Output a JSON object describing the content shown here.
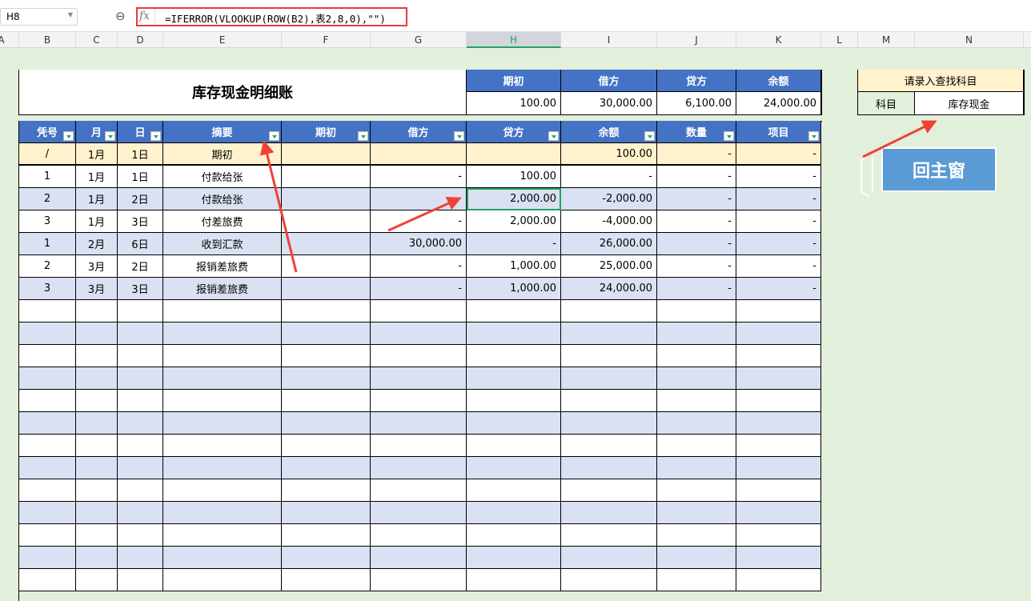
{
  "formula_bar": {
    "cell_ref": "H8",
    "fx": "fx",
    "formula": "=IFERROR(VLOOKUP(ROW(B2),表2,8,0),\"\")"
  },
  "columns": [
    "A",
    "B",
    "C",
    "D",
    "E",
    "F",
    "G",
    "H",
    "I",
    "J",
    "K",
    "L",
    "M",
    "N"
  ],
  "title": "库存现金明细账",
  "summary": {
    "headers": [
      "期初",
      "借方",
      "贷方",
      "余额"
    ],
    "values": [
      "100.00",
      "30,000.00",
      "6,100.00",
      "24,000.00"
    ]
  },
  "table": {
    "headers": [
      "凭号",
      "月",
      "日",
      "摘要",
      "期初",
      "借方",
      "贷方",
      "余额",
      "数量",
      "项目"
    ],
    "rows": [
      [
        "/",
        "1月",
        "1日",
        "期初",
        "",
        "",
        "",
        "100.00",
        "-",
        "-"
      ],
      [
        "1",
        "1月",
        "1日",
        "付款给张",
        "",
        "-",
        "100.00",
        "-",
        "-",
        "-"
      ],
      [
        "2",
        "1月",
        "2日",
        "付款给张",
        "",
        "",
        "2,000.00",
        "-2,000.00",
        "-",
        "-"
      ],
      [
        "3",
        "1月",
        "3日",
        "付差旅费",
        "",
        "-",
        "2,000.00",
        "-4,000.00",
        "-",
        "-"
      ],
      [
        "1",
        "2月",
        "6日",
        "收到汇款",
        "",
        "30,000.00",
        "-",
        "26,000.00",
        "-",
        "-"
      ],
      [
        "2",
        "3月",
        "2日",
        "报销差旅费",
        "",
        "-",
        "1,000.00",
        "25,000.00",
        "-",
        "-"
      ],
      [
        "3",
        "3月",
        "3日",
        "报销差旅费",
        "",
        "-",
        "1,000.00",
        "24,000.00",
        "-",
        "-"
      ]
    ]
  },
  "lookup": {
    "prompt": "请录入查找科目",
    "label": "科目",
    "value": "库存现金"
  },
  "button": {
    "label": "回主窗"
  },
  "colors": {
    "header": "#4472c4",
    "stripe": "#d9e1f2",
    "opening": "#fff2cc",
    "arrow": "#ef4136"
  }
}
